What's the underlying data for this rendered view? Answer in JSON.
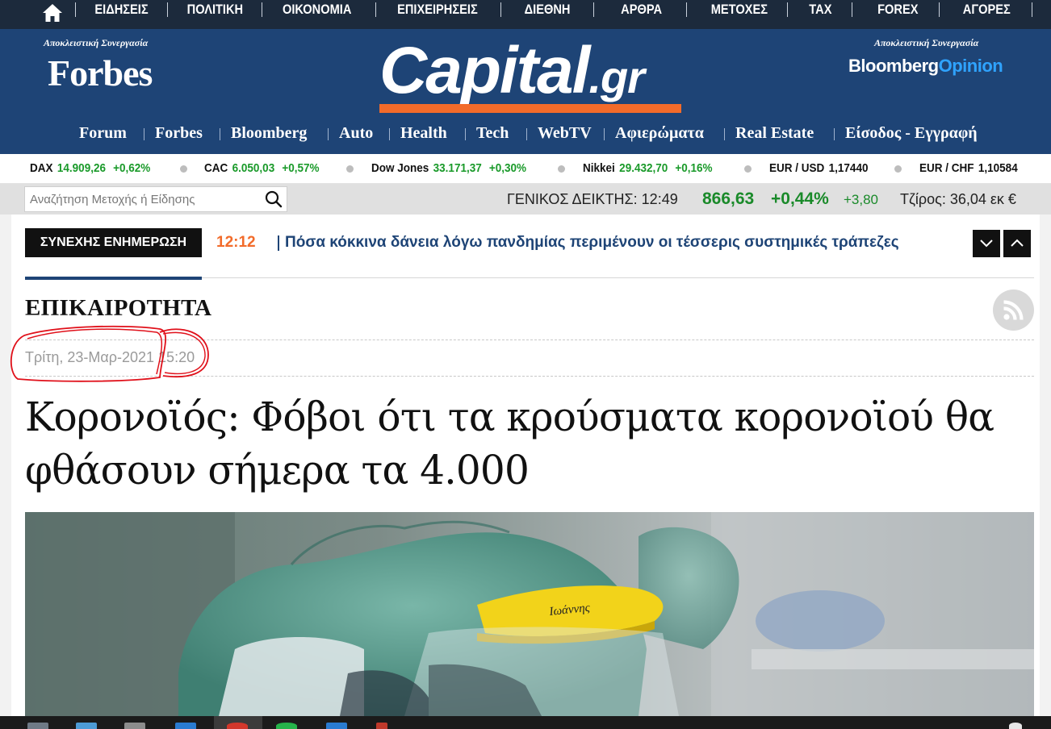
{
  "top_nav": {
    "items": [
      "ΕΙΔΗΣΕΙΣ",
      "ΠΟΛΙΤΙΚΗ",
      "ΟΙΚΟΝΟΜΙΑ",
      "ΕΠΙΧΕΙΡΗΣΕΙΣ",
      "ΔΙΕΘΝΗ",
      "ΑΡΘΡΑ",
      "ΜΕΤΟΧΕΣ",
      "TAX",
      "FOREX",
      "ΑΓΟΡΕΣ"
    ]
  },
  "masthead": {
    "left_partner_caption": "Αποκλειστική Συνεργασία",
    "left_partner_logo": "Forbes",
    "logo_word": "Capital",
    "logo_tld": ".gr",
    "right_partner_caption": "Αποκλειστική Συνεργασία",
    "right_partner_logo_main": "Bloomberg",
    "right_partner_logo_accent": "Opinion"
  },
  "section_nav": {
    "items": [
      "Forum",
      "Forbes",
      "Bloomberg",
      "Auto",
      "Health",
      "Tech",
      "WebTV",
      "Αφιερώματα",
      "Real Estate",
      "Είσοδος - Εγγραφή"
    ]
  },
  "ticker": [
    {
      "name": "DAX",
      "value": "14.909,26",
      "change": "+0,62%"
    },
    {
      "name": "CAC",
      "value": "6.050,03",
      "change": "+0,57%"
    },
    {
      "name": "Dow Jones",
      "value": "33.171,37",
      "change": "+0,30%"
    },
    {
      "name": "Nikkei",
      "value": "29.432,70",
      "change": "+0,16%"
    },
    {
      "name": "EUR / USD",
      "value": "1,17440"
    },
    {
      "name": "EUR / CHF",
      "value": "1,10584"
    }
  ],
  "search": {
    "placeholder": "Αναζήτηση Μετοχής ή Είδησης"
  },
  "general_index": {
    "label": "ΓΕΝΙΚΟΣ ΔΕΙΚΤΗΣ: 12:49",
    "value": "866,63",
    "pct_change": "+0,44%",
    "abs_change": "+3,80",
    "turnover": "Τζίρος: 36,04 εκ  €"
  },
  "breaking": {
    "label": "ΣΥΝΕΧΗΣ ΕΝΗΜΕΡΩΣΗ",
    "time": "12:12",
    "headline": "Πόσα κόκκινα δάνεια λόγω πανδημίας περιμένουν οι τέσσερις συστημικές τράπεζες"
  },
  "article": {
    "section": "ΕΠΙΚΑΙΡΟΤΗΤΑ",
    "date": "Τρίτη, 23-Μαρ-2021 15:20",
    "title": "Κορονοϊός: Φόβοι ότι τα κρούσματα κορονοϊού θα φθάσουν σήμερα τα 4.000",
    "visor_writing": "Ιωάννης"
  },
  "colors": {
    "nav_dark": "#1c2a3c",
    "masthead_blue": "#1e4476",
    "accent_orange": "#f26b2a",
    "positive_green": "#1a9a2a",
    "annotation_red": "#e0101a"
  }
}
